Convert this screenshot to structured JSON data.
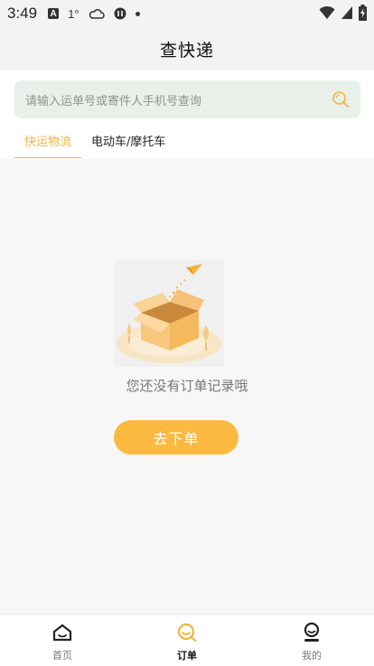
{
  "status_bar": {
    "time": "3:49",
    "indicator_text": "1°"
  },
  "header": {
    "title": "查快递"
  },
  "search": {
    "placeholder": "请输入运单号或寄件人手机号查询"
  },
  "tabs": [
    {
      "label": "快运物流",
      "active": true
    },
    {
      "label": "电动车/摩托车",
      "active": false
    }
  ],
  "empty_state": {
    "message": "您还没有订单记录哦",
    "button_label": "去下单"
  },
  "bottom_nav": [
    {
      "label": "首页",
      "icon": "home-icon",
      "active": false
    },
    {
      "label": "订单",
      "icon": "order-icon",
      "active": true
    },
    {
      "label": "我的",
      "icon": "profile-icon",
      "active": false
    }
  ],
  "colors": {
    "accent": "#fcb93f",
    "tab_active": "#f2b43d",
    "search_bg": "#e9efe9",
    "page_bg": "#f7f7f7"
  }
}
